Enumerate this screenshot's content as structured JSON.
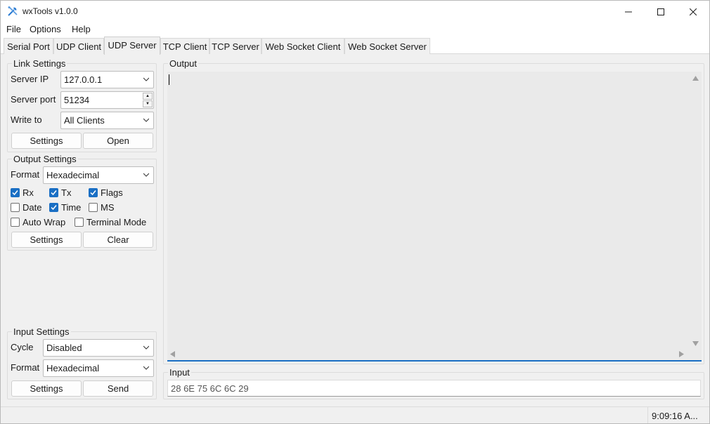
{
  "window": {
    "title": "wxTools v1.0.0",
    "icon": "tools-icon"
  },
  "menu": {
    "items": [
      "File",
      "Options",
      "Help"
    ]
  },
  "tabs": {
    "items": [
      "Serial Port",
      "UDP Client",
      "UDP Server",
      "TCP Client",
      "TCP Server",
      "Web Socket Client",
      "Web Socket Server"
    ],
    "active": "UDP Server"
  },
  "link_settings": {
    "title": "Link Settings",
    "server_ip_label": "Server IP",
    "server_ip_value": "127.0.0.1",
    "server_port_label": "Server port",
    "server_port_value": "51234",
    "write_to_label": "Write to",
    "write_to_value": "All Clients",
    "settings_button": "Settings",
    "open_button": "Open"
  },
  "output_settings": {
    "title": "Output Settings",
    "format_label": "Format",
    "format_value": "Hexadecimal",
    "rx_label": "Rx",
    "tx_label": "Tx",
    "flags_label": "Flags",
    "date_label": "Date",
    "time_label": "Time",
    "ms_label": "MS",
    "auto_wrap_label": "Auto Wrap",
    "terminal_mode_label": "Terminal Mode",
    "checked": {
      "rx": true,
      "tx": true,
      "flags": true,
      "date": false,
      "time": true,
      "ms": false,
      "auto_wrap": false,
      "terminal_mode": false
    },
    "settings_button": "Settings",
    "clear_button": "Clear"
  },
  "input_settings": {
    "title": "Input Settings",
    "cycle_label": "Cycle",
    "cycle_value": "Disabled",
    "format_label": "Format",
    "format_value": "Hexadecimal",
    "settings_button": "Settings",
    "send_button": "Send"
  },
  "output": {
    "title": "Output",
    "text": ""
  },
  "input": {
    "title": "Input",
    "value": "28 6E 75 6C 6C 29"
  },
  "status": {
    "time": "9:09:16 A..."
  },
  "colors": {
    "accent": "#1a6fc4",
    "window_bg": "#f0f0f0"
  }
}
